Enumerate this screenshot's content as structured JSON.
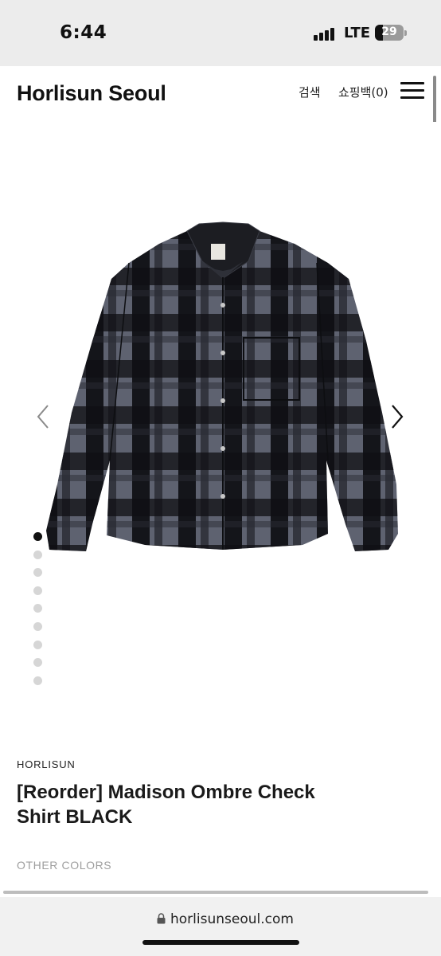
{
  "status_bar": {
    "time": "6:44",
    "network": "LTE",
    "battery_level": "29",
    "battery_fraction": 0.29
  },
  "header": {
    "logo": "Horlisun Seoul",
    "search_label": "검색",
    "cart_label": "쇼핑백(0)",
    "menu_icon": "hamburger-menu-icon"
  },
  "gallery": {
    "image_count": 9,
    "active_index": 0,
    "prev_icon": "chevron-left-icon",
    "next_icon": "chevron-right-icon"
  },
  "product": {
    "brand": "HORLISUN",
    "title_line1": "[Reorder] Madison Ombre Check",
    "title_line2": "Shirt BLACK",
    "other_colors_label": "OTHER COLORS"
  },
  "browser": {
    "url": "horlisunseoul.com",
    "lock_icon": "lock-icon"
  }
}
